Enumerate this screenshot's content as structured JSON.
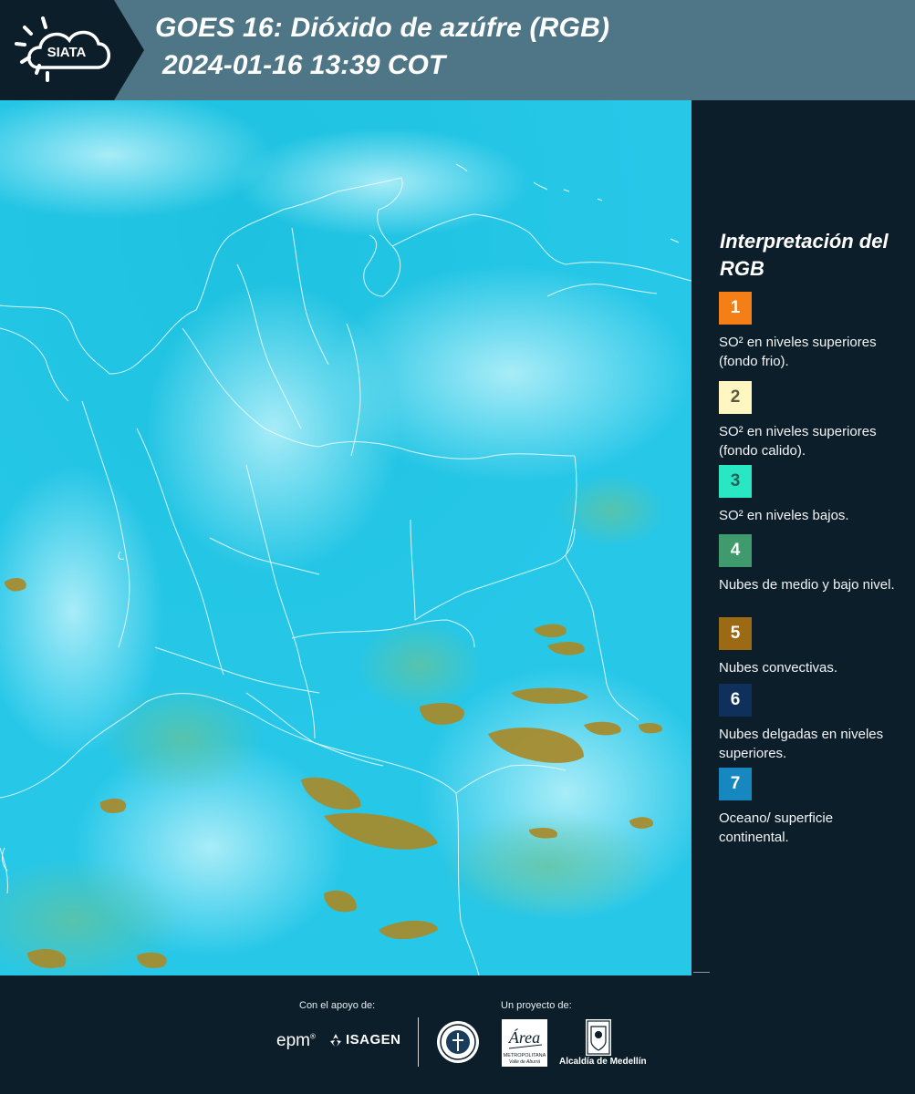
{
  "header": {
    "logo_text": "SIATA",
    "title_line1": "GOES 16: Dióxido de azúfre (RGB)",
    "title_line2": "2024-01-16 13:39 COT"
  },
  "legend": {
    "title": "Interpretación del RGB",
    "items": [
      {
        "number": "1",
        "color": "#f57f17",
        "text_color": "#ffffff",
        "label": "SO² en niveles superiores (fondo frio)."
      },
      {
        "number": "2",
        "color": "#fff6c2",
        "text_color": "#5a5a40",
        "label": "SO² en niveles superiores (fondo calido)."
      },
      {
        "number": "3",
        "color": "#2ae7c4",
        "text_color": "#2b5f5a",
        "label": "SO² en niveles bajos."
      },
      {
        "number": "4",
        "color": "#3f9b6e",
        "text_color": "#ffffff",
        "label": "Nubes de medio y bajo nivel."
      },
      {
        "number": "5",
        "color": "#9b6a12",
        "text_color": "#ffffff",
        "label": "Nubes convectivas."
      },
      {
        "number": "6",
        "color": "#10305c",
        "text_color": "#ffffff",
        "label": "Nubes delgadas en niveles superiores."
      },
      {
        "number": "7",
        "color": "#1788bf",
        "text_color": "#ffffff",
        "label": "Oceano/ superficie continental."
      }
    ]
  },
  "footer": {
    "support_label": "Con el apoyo de:",
    "project_label": "Un proyecto de:",
    "sponsor_epm": "epm",
    "sponsor_isagen": "ISAGEN",
    "area_logo_text": "Área",
    "area_logo_sub1": "METROPOLITANA",
    "area_logo_sub2": "Valle de Aburrá",
    "alcaldia_label": "Alcaldía de Medellín"
  },
  "colors": {
    "header_bg": "#4e7686",
    "logo_block_bg": "#0c1e2a",
    "panel_bg": "#0c1e2a",
    "map_base": "#23c5e6",
    "convective_cloud": "#a88a2a"
  }
}
